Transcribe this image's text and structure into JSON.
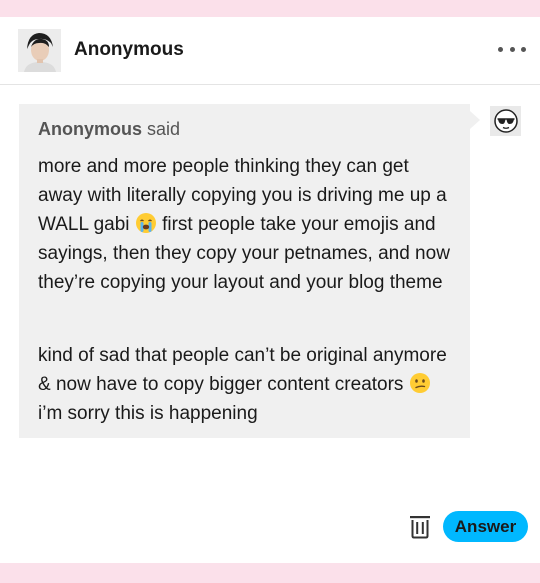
{
  "post": {
    "author": "Anonymous",
    "author_avatar_icon": "user-photo-avatar",
    "more_icon": "more-horizontal-icon"
  },
  "ask": {
    "asker_name": "Anonymous",
    "said_label": "said",
    "asker_icon": "anonymous-sunglasses-icon",
    "paragraph1": {
      "part1": "more and more people thinking they can get away with literally copying you is driving me up a WALL gabi",
      "emoji1": "loudly-crying-emoji",
      "part2": "first people take your emojis and sayings, then they copy your petnames, and now they’re copying your layout and your blog theme"
    },
    "paragraph2": {
      "part1": "kind of sad that people can’t be original anymore & now have to copy bigger content creators",
      "emoji2": "confused-emoji",
      "part2": "i’m sorry this is happening"
    }
  },
  "footer": {
    "delete_icon": "trash-icon",
    "answer_label": "Answer"
  },
  "colors": {
    "page_background": "#fbe0ea",
    "answer_button": "#00b8ff",
    "bubble": "#f0f0f0"
  }
}
